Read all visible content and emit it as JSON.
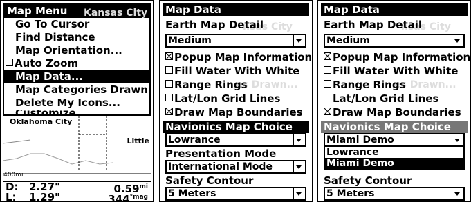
{
  "panel1": {
    "title": "Map Menu",
    "items": [
      {
        "label": "Go To Cursor"
      },
      {
        "label": "Find Distance"
      },
      {
        "label": "Map Orientation..."
      },
      {
        "label": "Auto Zoom"
      },
      {
        "label": "Map Data..."
      },
      {
        "label": "Map Categories Drawn..."
      },
      {
        "label": "Delete My Icons..."
      },
      {
        "label": "Customize..."
      }
    ],
    "map": {
      "city1": "Oklahoma City",
      "city2": "Little",
      "scale": "400mi",
      "ghost": "Kansas City"
    },
    "stats": {
      "d_label": "D:",
      "d_value": "2.27\"",
      "d_right": "0.59",
      "d_unit": "mi",
      "l_label": "L:",
      "l_value": "1.29\"",
      "l_right": "344",
      "l_unit": "°mag"
    }
  },
  "mapdata": {
    "title": "Map Data",
    "earth_label": "Earth Map Detail",
    "earth_value": "Medium",
    "opts": [
      "Popup Map Information",
      "Fill Water With White",
      "Range Rings",
      "Lat/Lon Grid Lines",
      "Draw Map Boundaries"
    ],
    "checked": [
      true,
      false,
      false,
      false,
      true
    ],
    "navionics_label": "Navionics Map Choice",
    "pres_label": "Presentation Mode",
    "pres_value": "International Mode",
    "safety_label": "Safety Contour",
    "safety_value": "5 Meters",
    "ghost1": "nsas City",
    "ghost2": "es Drawn..."
  },
  "panel2": {
    "navionics_value": "Lowrance"
  },
  "panel3": {
    "navionics_value": "Miami Demo",
    "list": [
      "Lowrance",
      "Miami Demo"
    ]
  }
}
